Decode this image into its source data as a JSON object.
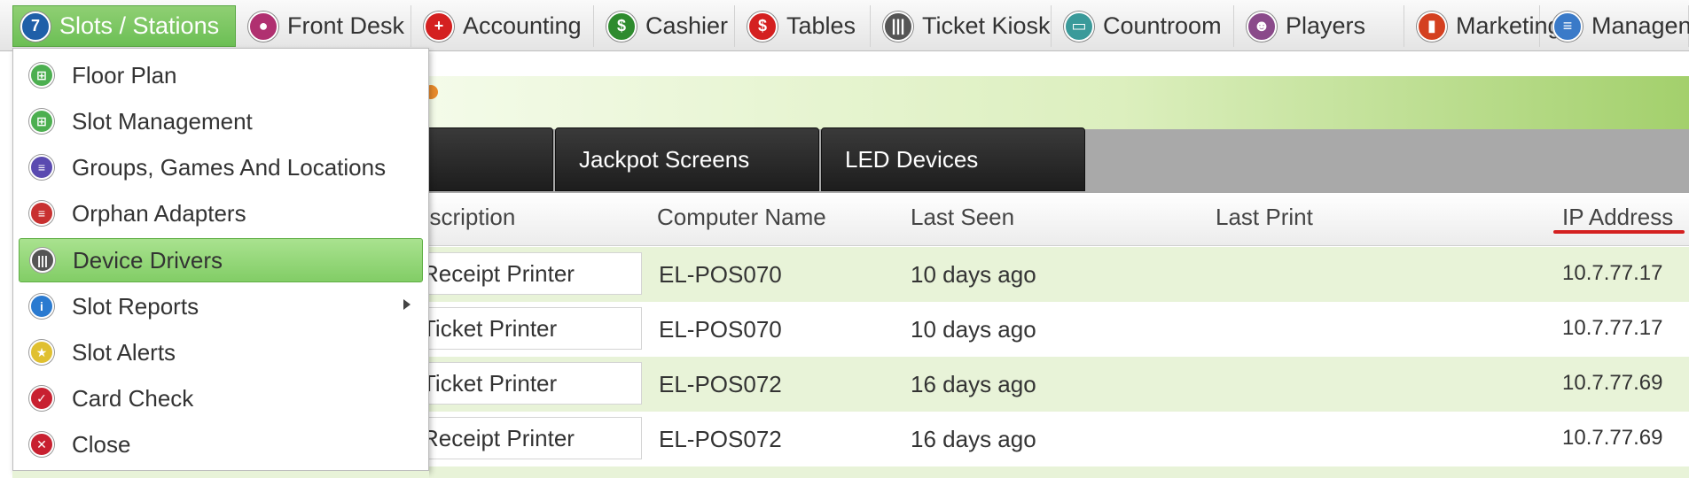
{
  "menubar": {
    "items": [
      {
        "label": "Slots / Stations",
        "icon": "slot-7-icon",
        "glyph": "7",
        "color": "#1f5fa8",
        "active": true
      },
      {
        "label": "Front Desk",
        "icon": "front-desk-icon",
        "glyph": "●",
        "color": "#b03070",
        "active": false
      },
      {
        "label": "Accounting",
        "icon": "plus-icon",
        "glyph": "+",
        "color": "#d42020",
        "active": false
      },
      {
        "label": "Cashier",
        "icon": "dollar-icon",
        "glyph": "$",
        "color": "#2e8b2e",
        "active": false
      },
      {
        "label": "Tables",
        "icon": "chip-icon",
        "glyph": "$",
        "color": "#d42020",
        "active": false
      },
      {
        "label": "Ticket Kiosk",
        "icon": "barcode-icon",
        "glyph": "|||",
        "color": "#555555",
        "active": false
      },
      {
        "label": "Countroom",
        "icon": "money-icon",
        "glyph": "▭",
        "color": "#3a9a9a",
        "active": false
      },
      {
        "label": "Players",
        "icon": "players-icon",
        "glyph": "☻",
        "color": "#8a4a8a",
        "active": false
      },
      {
        "label": "Marketing",
        "icon": "chart-icon",
        "glyph": "▮",
        "color": "#d44020",
        "active": false
      },
      {
        "label": "Managen",
        "icon": "document-icon",
        "glyph": "≡",
        "color": "#3a7ac8",
        "active": false
      }
    ]
  },
  "dropdown": {
    "items": [
      {
        "label": "Floor Plan",
        "icon": "grid-icon",
        "glyph": "⊞",
        "color": "#4caf50",
        "selected": false,
        "submenu": false
      },
      {
        "label": "Slot Management",
        "icon": "grid-icon",
        "glyph": "⊞",
        "color": "#4caf50",
        "selected": false,
        "submenu": false
      },
      {
        "label": "Groups, Games And Locations",
        "icon": "stack-icon",
        "glyph": "≡",
        "color": "#5a4ab0",
        "selected": false,
        "submenu": false
      },
      {
        "label": "Orphan Adapters",
        "icon": "adapter-icon",
        "glyph": "≡",
        "color": "#c83030",
        "selected": false,
        "submenu": false
      },
      {
        "label": "Device Drivers",
        "icon": "barcode-icon",
        "glyph": "|||",
        "color": "#555555",
        "selected": true,
        "submenu": false
      },
      {
        "label": "Slot Reports",
        "icon": "info-icon",
        "glyph": "i",
        "color": "#2a7ad0",
        "selected": false,
        "submenu": true
      },
      {
        "label": "Slot Alerts",
        "icon": "star-icon",
        "glyph": "★",
        "color": "#e0c030",
        "selected": false,
        "submenu": false
      },
      {
        "label": "Card Check",
        "icon": "check-icon",
        "glyph": "✓",
        "color": "#c82030",
        "selected": false,
        "submenu": false
      },
      {
        "label": "Close",
        "icon": "close-icon",
        "glyph": "✕",
        "color": "#c82030",
        "selected": false,
        "submenu": false
      }
    ]
  },
  "tabs": [
    {
      "label": ""
    },
    {
      "label": "Jackpot Screens"
    },
    {
      "label": "LED Devices"
    }
  ],
  "table": {
    "columns": [
      "escription",
      "Computer Name",
      "Last Seen",
      "Last Print",
      "IP Address"
    ],
    "rows": [
      {
        "description": "Receipt Printer",
        "computer": "EL-POS070",
        "last_seen": "10 days ago",
        "last_print": "",
        "ip": "10.7.77.17"
      },
      {
        "description": "Ticket Printer",
        "computer": "EL-POS070",
        "last_seen": "10 days ago",
        "last_print": "",
        "ip": "10.7.77.17"
      },
      {
        "description": "Ticket Printer",
        "computer": "EL-POS072",
        "last_seen": "16 days ago",
        "last_print": "",
        "ip": "10.7.77.69"
      },
      {
        "description": "Receipt Printer",
        "computer": "EL-POS072",
        "last_seen": "16 days ago",
        "last_print": "",
        "ip": "10.7.77.69"
      }
    ]
  }
}
